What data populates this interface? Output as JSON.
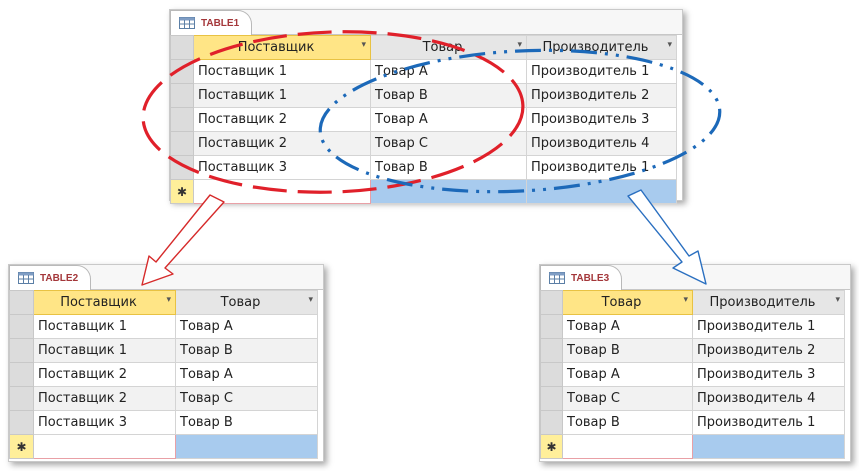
{
  "table1": {
    "title": "TABLE1",
    "columns": [
      "Поставщик",
      "Товар",
      "Производитель"
    ],
    "rows": [
      [
        "Поставщик 1",
        "Товар A",
        "Производитель 1"
      ],
      [
        "Поставщик 1",
        "Товар B",
        "Производитель 2"
      ],
      [
        "Поставщик 2",
        "Товар A",
        "Производитель 3"
      ],
      [
        "Поставщик 2",
        "Товар C",
        "Производитель 4"
      ],
      [
        "Поставщик 3",
        "Товар B",
        "Производитель 1"
      ]
    ],
    "new_row_marker": "✱"
  },
  "table2": {
    "title": "TABLE2",
    "columns": [
      "Поставщик",
      "Товар"
    ],
    "rows": [
      [
        "Поставщик 1",
        "Товар A"
      ],
      [
        "Поставщик 1",
        "Товар B"
      ],
      [
        "Поставщик 2",
        "Товар A"
      ],
      [
        "Поставщик 2",
        "Товар C"
      ],
      [
        "Поставщик 3",
        "Товар B"
      ]
    ],
    "new_row_marker": "✱"
  },
  "table3": {
    "title": "TABLE3",
    "columns": [
      "Товар",
      "Производитель"
    ],
    "rows": [
      [
        "Товар A",
        "Производитель 1"
      ],
      [
        "Товар B",
        "Производитель 2"
      ],
      [
        "Товар A",
        "Производитель 3"
      ],
      [
        "Товар C",
        "Производитель 4"
      ],
      [
        "Товар B",
        "Производитель 1"
      ]
    ],
    "new_row_marker": "✱"
  },
  "icons": {
    "table_icon": "table-icon",
    "dropdown": "▾"
  },
  "colors": {
    "tab_title": "#a4373a",
    "selected_header": "#ffe586",
    "new_row": "#a8cbee",
    "red_annotation": "#e0202a",
    "blue_annotation": "#1c69b9"
  }
}
